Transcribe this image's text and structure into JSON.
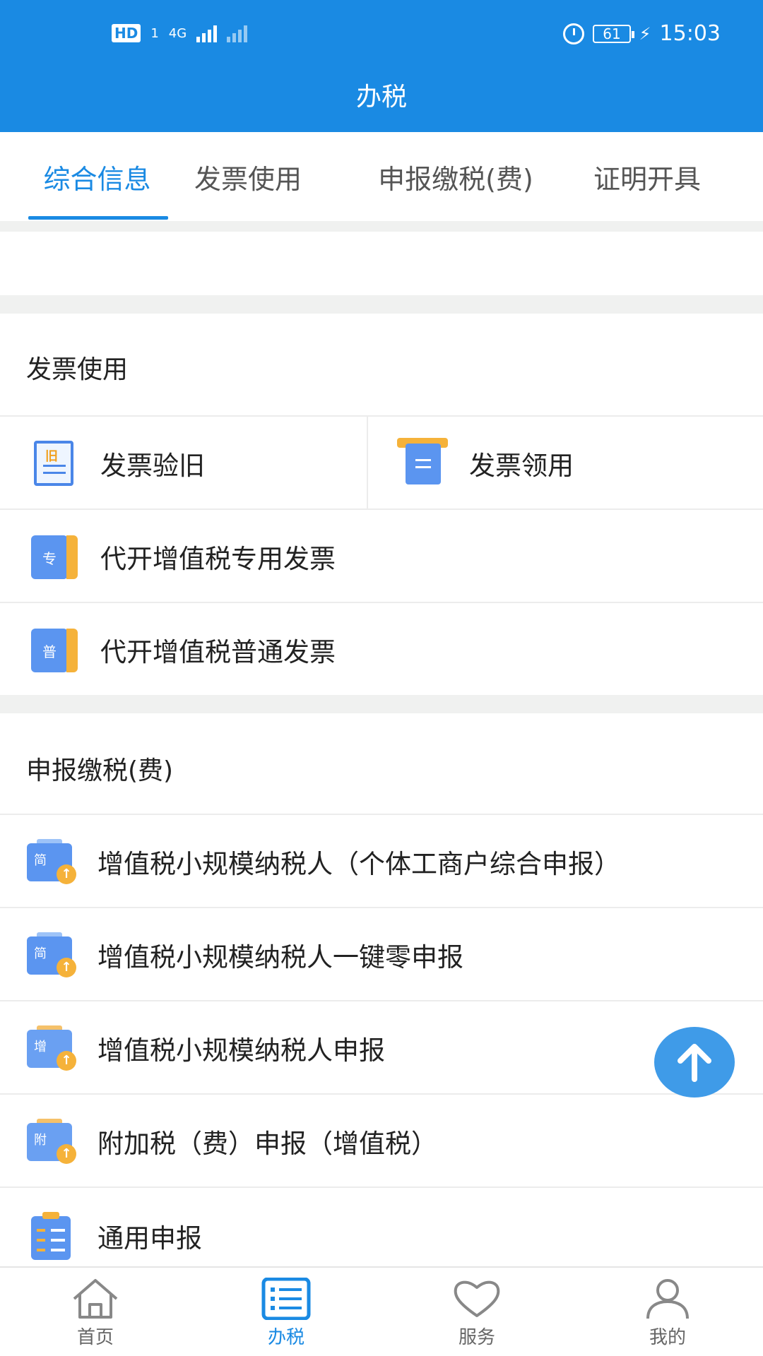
{
  "status_bar": {
    "hd": "HD",
    "sim": "1",
    "network": "4G",
    "battery": "61",
    "time": "15:03"
  },
  "header": {
    "title": "办税"
  },
  "tabs": [
    {
      "label": "综合信息",
      "active": true
    },
    {
      "label": "发票使用",
      "active": false
    },
    {
      "label": "申报缴税(费)",
      "active": false
    },
    {
      "label": "证明开具",
      "active": false
    }
  ],
  "invoice_section": {
    "title": "发票使用",
    "items": [
      {
        "label": "发票验旧",
        "icon": "invoice-check-icon",
        "icon_text": "旧"
      },
      {
        "label": "发票领用",
        "icon": "invoice-receive-icon"
      },
      {
        "label": "代开增值税专用发票",
        "icon": "special-invoice-icon",
        "icon_text": "专"
      },
      {
        "label": "代开增值税普通发票",
        "icon": "ordinary-invoice-icon",
        "icon_text": "普"
      }
    ]
  },
  "declare_section": {
    "title": "申报缴税(费)",
    "items": [
      {
        "label": "增值税小规模纳税人（个体工商户综合申报）",
        "icon": "simple-declare-icon",
        "icon_text": "简"
      },
      {
        "label": "增值税小规模纳税人一键零申报",
        "icon": "simple-declare-icon",
        "icon_text": "简"
      },
      {
        "label": "增值税小规模纳税人申报",
        "icon": "vat-declare-icon",
        "icon_text": "增"
      },
      {
        "label": "附加税（费）申报（增值税）",
        "icon": "surtax-declare-icon",
        "icon_text": "附"
      },
      {
        "label": "通用申报",
        "icon": "general-declare-icon"
      }
    ]
  },
  "bottom_nav": [
    {
      "label": "首页",
      "icon": "home-icon",
      "active": false
    },
    {
      "label": "办税",
      "icon": "list-icon",
      "active": true
    },
    {
      "label": "服务",
      "icon": "heart-icon",
      "active": false
    },
    {
      "label": "我的",
      "icon": "user-icon",
      "active": false
    }
  ],
  "colors": {
    "primary": "#1a8ae3",
    "accent": "#f5b23a",
    "icon_blue": "#5b95f0",
    "gap": "#f0f1f0"
  }
}
